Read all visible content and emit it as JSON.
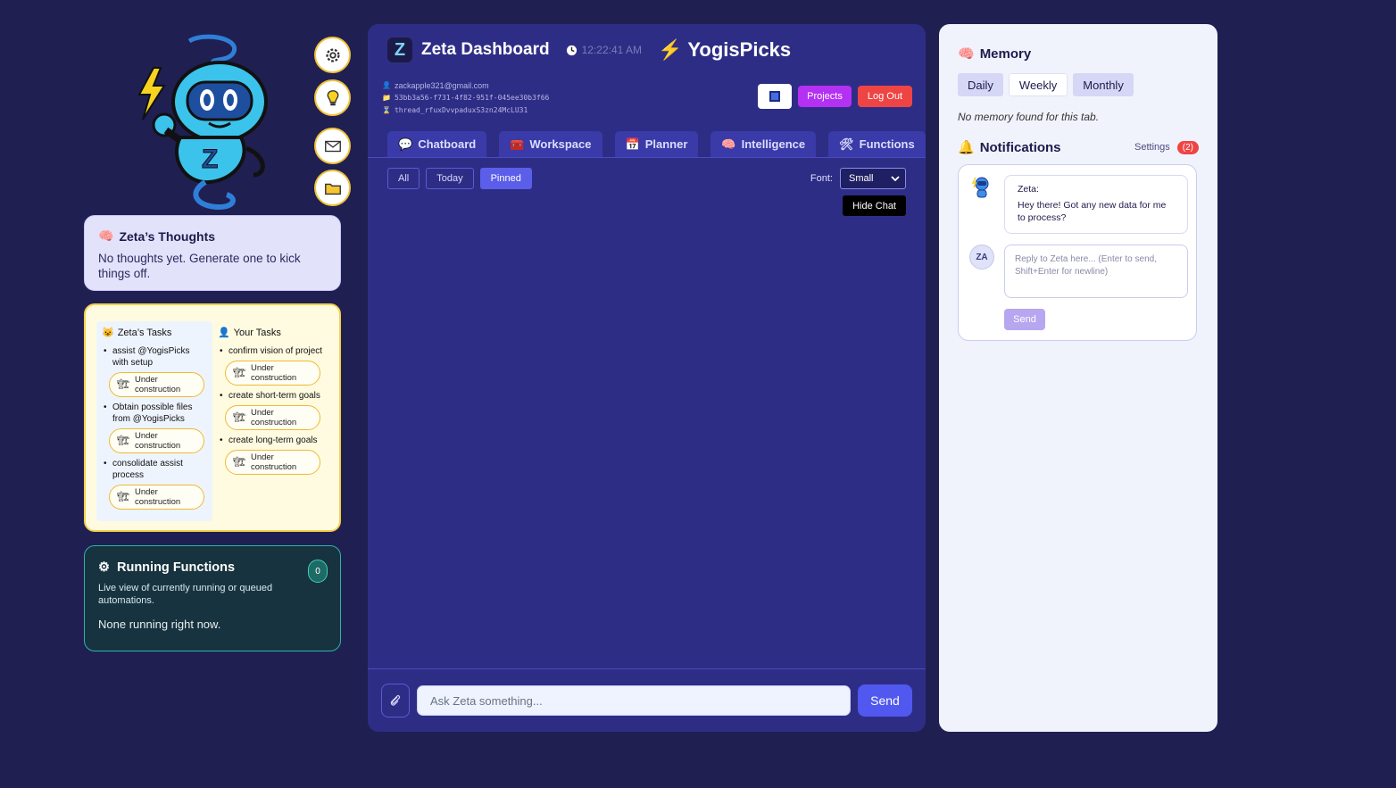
{
  "sidebar": {
    "buttons": [
      {
        "icon": "gear-icon"
      },
      {
        "icon": "lightbulb-icon"
      },
      {
        "icon": "mail-icon"
      },
      {
        "icon": "folder-icon"
      }
    ],
    "thoughts": {
      "icon": "🧠",
      "title": "Zeta’s Thoughts",
      "text": "No thoughts yet. Generate one to kick things off."
    },
    "tasks": {
      "zeta": {
        "icon": "😺",
        "title": "Zeta’s Tasks",
        "items": [
          {
            "text": "assist @YogisPicks with setup",
            "status": "Under construction"
          },
          {
            "text": "Obtain possible files from @YogisPicks",
            "status": "Under construction"
          },
          {
            "text": "consolidate assist process",
            "status": "Under construction"
          }
        ]
      },
      "user": {
        "icon": "👤",
        "title": "Your Tasks",
        "items": [
          {
            "text": "confirm vision of project",
            "status": "Under construction"
          },
          {
            "text": "create short-term goals",
            "status": "Under construction"
          },
          {
            "text": "create long-term goals",
            "status": "Under construction"
          }
        ]
      },
      "status_icon": "🏗"
    },
    "running": {
      "icon": "⚙",
      "title": "Running Functions",
      "count": "0",
      "description": "Live view of currently running or queued automations.",
      "empty": "None running right now."
    }
  },
  "header": {
    "logo": "Z",
    "title": "Zeta Dashboard",
    "time": "12:22:41 AM",
    "project_icon": "⚡",
    "project": "YogisPicks",
    "email": "zackapple321@gmail.com",
    "project_id": "53bb3a56-f731-4f82-951f-045ee30b3f66",
    "thread_id": "thread_rfuxDvvpaduxS3zn24McLU31",
    "projects_label": "Projects",
    "logout_label": "Log Out"
  },
  "tabs": [
    {
      "icon": "💬",
      "label": "Chatboard"
    },
    {
      "icon": "🧰",
      "label": "Workspace"
    },
    {
      "icon": "📅",
      "label": "Planner"
    },
    {
      "icon": "🧠",
      "label": "Intelligence"
    },
    {
      "icon": "🛠",
      "label": "Functions"
    }
  ],
  "filters": {
    "all": "All",
    "today": "Today",
    "pinned": "Pinned",
    "active": "Pinned",
    "font_label": "Font:",
    "font_value": "Small",
    "hide_chat": "Hide Chat"
  },
  "composer": {
    "placeholder": "Ask Zeta something...",
    "send": "Send"
  },
  "memory": {
    "icon": "🧠",
    "title": "Memory",
    "tabs": [
      "Daily",
      "Weekly",
      "Monthly"
    ],
    "active_tab": "Weekly",
    "empty": "No memory found for this tab."
  },
  "notifications": {
    "icon": "🔔",
    "title": "Notifications",
    "settings": "Settings",
    "badge": "(2)",
    "message_sender": "Zeta:",
    "message_text": "Hey there! Got any new data for me to process?",
    "user_initials": "ZA",
    "reply_placeholder": "Reply to Zeta here... (Enter to send, Shift+Enter for newline)",
    "send": "Send"
  },
  "colors": {
    "background": "#1f1f52",
    "main_panel": "#2e2d86",
    "accent": "#5058ef",
    "projects_button": "#b430f3",
    "logout_button": "#ef4444",
    "tasks_border": "#f5cf4b",
    "running_border": "#2cb6a6"
  }
}
